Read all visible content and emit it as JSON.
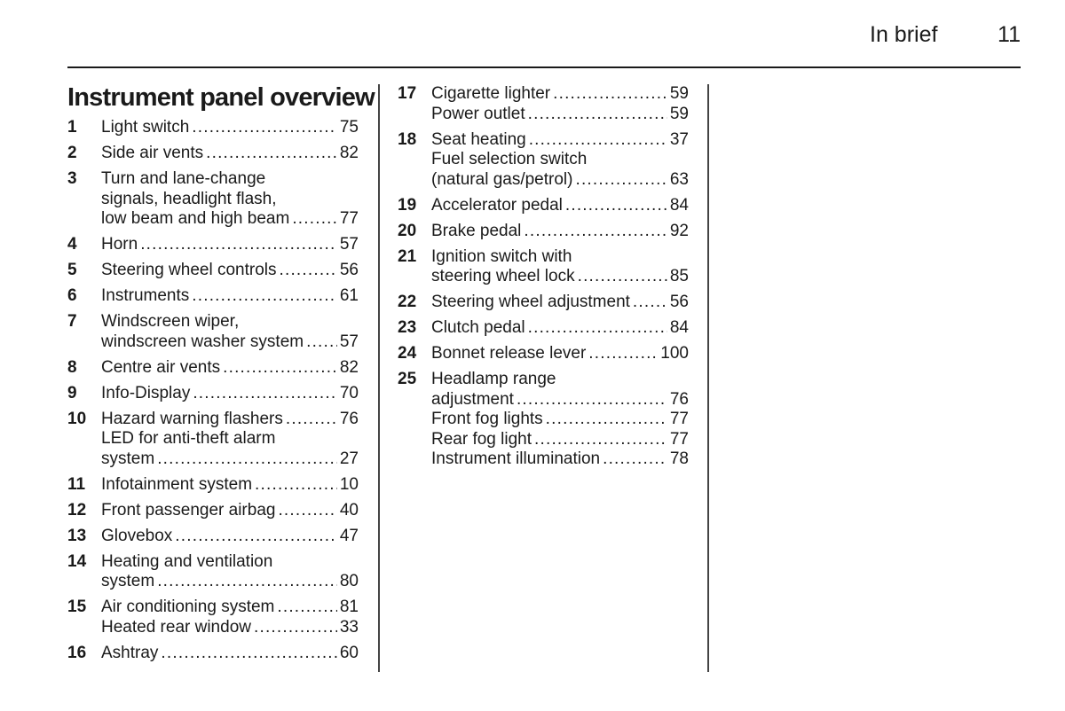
{
  "header": {
    "section": "In brief",
    "page_number": "11"
  },
  "title": "Instrument panel overview",
  "left_column": [
    {
      "num": "1",
      "lines": [
        {
          "text": "Light switch",
          "page": "75"
        }
      ]
    },
    {
      "num": "2",
      "lines": [
        {
          "text": "Side air vents",
          "page": "82"
        }
      ]
    },
    {
      "num": "3",
      "lines": [
        {
          "text": "Turn and lane-change",
          "page": null
        },
        {
          "text": "signals, headlight flash,",
          "page": null
        },
        {
          "text": "low beam and high beam",
          "page": "77"
        }
      ]
    },
    {
      "num": "4",
      "lines": [
        {
          "text": "Horn",
          "page": "57"
        }
      ]
    },
    {
      "num": "5",
      "lines": [
        {
          "text": "Steering wheel controls",
          "page": "56"
        }
      ]
    },
    {
      "num": "6",
      "lines": [
        {
          "text": "Instruments",
          "page": "61"
        }
      ]
    },
    {
      "num": "7",
      "lines": [
        {
          "text": "Windscreen wiper,",
          "page": null
        },
        {
          "text": "windscreen washer system",
          "page": "57"
        }
      ]
    },
    {
      "num": "8",
      "lines": [
        {
          "text": "Centre air vents",
          "page": "82"
        }
      ]
    },
    {
      "num": "9",
      "lines": [
        {
          "text": "Info-Display",
          "page": "70"
        }
      ]
    },
    {
      "num": "10",
      "lines": [
        {
          "text": "Hazard warning flashers",
          "page": "76"
        },
        {
          "text": "LED for anti-theft alarm",
          "page": null
        },
        {
          "text": "system",
          "page": "27"
        }
      ]
    },
    {
      "num": "11",
      "lines": [
        {
          "text": "Infotainment system",
          "page": "10"
        }
      ]
    },
    {
      "num": "12",
      "lines": [
        {
          "text": "Front passenger airbag",
          "page": "40"
        }
      ]
    },
    {
      "num": "13",
      "lines": [
        {
          "text": "Glovebox",
          "page": "47"
        }
      ]
    },
    {
      "num": "14",
      "lines": [
        {
          "text": "Heating and ventilation",
          "page": null
        },
        {
          "text": "system",
          "page": "80"
        }
      ]
    },
    {
      "num": "15",
      "lines": [
        {
          "text": "Air conditioning system",
          "page": "81"
        },
        {
          "text": "Heated rear window",
          "page": "33"
        }
      ]
    },
    {
      "num": "16",
      "lines": [
        {
          "text": "Ashtray",
          "page": "60"
        }
      ]
    }
  ],
  "right_column": [
    {
      "num": "17",
      "lines": [
        {
          "text": "Cigarette lighter",
          "page": "59"
        },
        {
          "text": "Power outlet",
          "page": "59"
        }
      ]
    },
    {
      "num": "18",
      "lines": [
        {
          "text": "Seat heating",
          "page": "37"
        },
        {
          "text": "Fuel selection switch",
          "page": null
        },
        {
          "text": "(natural gas/petrol)",
          "page": "63"
        }
      ]
    },
    {
      "num": "19",
      "lines": [
        {
          "text": "Accelerator pedal",
          "page": "84"
        }
      ]
    },
    {
      "num": "20",
      "lines": [
        {
          "text": "Brake pedal",
          "page": "92"
        }
      ]
    },
    {
      "num": "21",
      "lines": [
        {
          "text": "Ignition switch with",
          "page": null
        },
        {
          "text": "steering wheel lock",
          "page": "85"
        }
      ]
    },
    {
      "num": "22",
      "lines": [
        {
          "text": "Steering wheel adjustment",
          "page": "56"
        }
      ]
    },
    {
      "num": "23",
      "lines": [
        {
          "text": "Clutch pedal",
          "page": "84"
        }
      ]
    },
    {
      "num": "24",
      "lines": [
        {
          "text": "Bonnet release lever",
          "page": "100"
        }
      ]
    },
    {
      "num": "25",
      "lines": [
        {
          "text": "Headlamp range",
          "page": null
        },
        {
          "text": "adjustment",
          "page": "76"
        },
        {
          "text": "Front fog lights",
          "page": "77"
        },
        {
          "text": "Rear fog light",
          "page": "77"
        },
        {
          "text": "Instrument illumination",
          "page": "78"
        }
      ]
    }
  ]
}
